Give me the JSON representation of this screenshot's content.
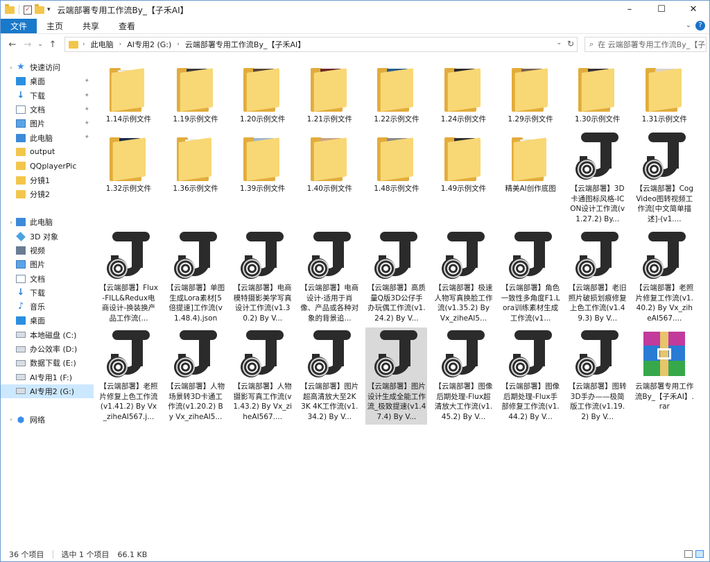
{
  "window": {
    "title": "云端部署专用工作流By_【子禾AI】",
    "controls": {
      "minimize": "–",
      "maximize": "☐",
      "close": "✕"
    }
  },
  "ribbon": {
    "tabs": [
      "文件",
      "主页",
      "共享",
      "查看"
    ],
    "help": "?"
  },
  "address": {
    "crumbs": [
      "此电脑",
      "AI专用2 (G:)",
      "云端部署专用工作流By_【子禾AI】"
    ],
    "search_placeholder": "在 云端部署专用工作流By_【子..."
  },
  "nav": {
    "items": [
      {
        "label": "快速访问",
        "icon": "star-icon",
        "pin": false,
        "sel": false,
        "exp": true
      },
      {
        "label": "桌面",
        "icon": "desktop-icon",
        "pin": true,
        "sel": false,
        "exp": false
      },
      {
        "label": "下载",
        "icon": "download-icon",
        "pin": true,
        "sel": false,
        "exp": false
      },
      {
        "label": "文档",
        "icon": "document-icon",
        "pin": true,
        "sel": false,
        "exp": false
      },
      {
        "label": "图片",
        "icon": "picture-icon",
        "pin": true,
        "sel": false,
        "exp": false
      },
      {
        "label": "此电脑",
        "icon": "computer-icon",
        "pin": true,
        "sel": false,
        "exp": false
      },
      {
        "label": "output",
        "icon": "folder-icon",
        "pin": false,
        "sel": false,
        "exp": false
      },
      {
        "label": "QQplayerPic",
        "icon": "folder-icon",
        "pin": false,
        "sel": false,
        "exp": false
      },
      {
        "label": "分镜1",
        "icon": "folder-icon",
        "pin": false,
        "sel": false,
        "exp": false
      },
      {
        "label": "分镜2",
        "icon": "folder-icon",
        "pin": false,
        "sel": false,
        "exp": false
      },
      {
        "label": "",
        "icon": "",
        "pin": false,
        "sel": false,
        "exp": false
      },
      {
        "label": "此电脑",
        "icon": "computer-icon",
        "pin": false,
        "sel": false,
        "exp": true
      },
      {
        "label": "3D 对象",
        "icon": "3d-objects-icon",
        "pin": false,
        "sel": false,
        "exp": false
      },
      {
        "label": "视频",
        "icon": "video-icon",
        "pin": false,
        "sel": false,
        "exp": false
      },
      {
        "label": "图片",
        "icon": "picture-icon",
        "pin": false,
        "sel": false,
        "exp": false
      },
      {
        "label": "文档",
        "icon": "document-icon",
        "pin": false,
        "sel": false,
        "exp": false
      },
      {
        "label": "下载",
        "icon": "download-icon",
        "pin": false,
        "sel": false,
        "exp": false
      },
      {
        "label": "音乐",
        "icon": "music-icon",
        "pin": false,
        "sel": false,
        "exp": false
      },
      {
        "label": "桌面",
        "icon": "desktop-icon",
        "pin": false,
        "sel": false,
        "exp": false
      },
      {
        "label": "本地磁盘 (C:)",
        "icon": "drive-icon",
        "pin": false,
        "sel": false,
        "exp": false
      },
      {
        "label": "办公效率 (D:)",
        "icon": "drive-icon",
        "pin": false,
        "sel": false,
        "exp": false
      },
      {
        "label": "数据下载 (E:)",
        "icon": "drive-icon",
        "pin": false,
        "sel": false,
        "exp": false
      },
      {
        "label": "AI专用1 (F:)",
        "icon": "drive-icon",
        "pin": false,
        "sel": false,
        "exp": false
      },
      {
        "label": "AI专用2 (G:)",
        "icon": "drive-icon",
        "pin": false,
        "sel": true,
        "exp": false
      },
      {
        "label": "",
        "icon": "",
        "pin": false,
        "sel": false,
        "exp": false
      },
      {
        "label": "网络",
        "icon": "network-icon",
        "pin": false,
        "sel": false,
        "exp": true
      }
    ]
  },
  "files": [
    {
      "label": "1.14示例文件",
      "type": "folder",
      "photo": ""
    },
    {
      "label": "1.19示例文件",
      "type": "folder",
      "photo": "#3a3a3a"
    },
    {
      "label": "1.20示例文件",
      "type": "folder",
      "photo": "#5a4636"
    },
    {
      "label": "1.21示例文件",
      "type": "folder",
      "photo": "#6b2a2a"
    },
    {
      "label": "1.22示例文件",
      "type": "folder",
      "photo": "#2a5e8a"
    },
    {
      "label": "1.24示例文件",
      "type": "folder",
      "photo": "#2b2b2b"
    },
    {
      "label": "1.29示例文件",
      "type": "folder",
      "photo": "#7a6450"
    },
    {
      "label": "1.30示例文件",
      "type": "folder",
      "photo": "#3b3434"
    },
    {
      "label": "1.31示例文件",
      "type": "folder",
      "photo": "#d9d3cc"
    },
    {
      "label": "1.32示例文件",
      "type": "folder",
      "photo": "#1e2a4a"
    },
    {
      "label": "1.36示例文件",
      "type": "folder",
      "photo": ""
    },
    {
      "label": "1.39示例文件",
      "type": "folder",
      "photo": "#9cb6cf"
    },
    {
      "label": "1.40示例文件",
      "type": "folder",
      "photo": "#caa184"
    },
    {
      "label": "1.48示例文件",
      "type": "folder",
      "photo": "#8a8a8a"
    },
    {
      "label": "1.49示例文件",
      "type": "folder",
      "photo": "#2e2e2e"
    },
    {
      "label": "精美AI创作底图",
      "type": "folder",
      "photo": ""
    },
    {
      "label": "【云端部署】3D卡通图标风格-ICON设计工作流(v1.27.2) By...",
      "type": "json"
    },
    {
      "label": "【云端部署】CogVideo图转视频工作流[中文简单描述]-(v1....",
      "type": "json"
    },
    {
      "label": "【云端部署】Flux-FILL&Redux电商设计-换装换产品工作流(...",
      "type": "json"
    },
    {
      "label": "【云端部署】单图生成Lora素材[5倍提速]工作流(v1.48.4).json",
      "type": "json"
    },
    {
      "label": "【云端部署】电商模特摄影美学写真设计工作流(v1.30.2) By V...",
      "type": "json"
    },
    {
      "label": "【云端部署】电商设计-适用于肖像、产品或各种对象的背景追...",
      "type": "json"
    },
    {
      "label": "【云端部署】高质量Q版3D公仔手办玩偶工作流(v1.24.2) By V...",
      "type": "json"
    },
    {
      "label": "【云端部署】极速人物写真换脸工作流(v1.35.2) By Vx_ziheAI5...",
      "type": "json"
    },
    {
      "label": "【云端部署】角色一致性多角度F1.Lora训练素材生成工作流(v1...",
      "type": "json"
    },
    {
      "label": "【云端部署】老旧照片破损划痕修复上色工作流(v1.49.3) By V...",
      "type": "json"
    },
    {
      "label": "【云端部署】老照片修复工作流(v1.40.2) By Vx_ziheAI567....",
      "type": "json"
    },
    {
      "label": "【云端部署】老照片修复上色工作流(v1.41.2) By Vx_ziheAI567.j...",
      "type": "json"
    },
    {
      "label": "【云端部署】人物场景转3D卡通工作流(v1.20.2) By Vx_ziheAI5...",
      "type": "json"
    },
    {
      "label": "【云端部署】人物摄影写真工作流(v1.43.2) By Vx_ziheAI567....",
      "type": "json"
    },
    {
      "label": "【云端部署】图片超高清放大至2K 3K 4K工作流(v1.34.2) By V...",
      "type": "json"
    },
    {
      "label": "【云端部署】图片设计生成全能工作流_极致提速(v1.47.4) By V...",
      "type": "json",
      "sel": true
    },
    {
      "label": "【云端部署】图像后期处理-Flux超清放大工作流(v1.45.2) By V...",
      "type": "json"
    },
    {
      "label": "【云端部署】图像后期处理-Flux手部修复工作流(v1.44.2) By V...",
      "type": "json"
    },
    {
      "label": "【云端部署】图转3D手办——极简版工作流(v1.19.2) By V...",
      "type": "json"
    },
    {
      "label": "云端部署专用工作流By_【子禾AI】.rar",
      "type": "rar"
    }
  ],
  "status": {
    "count": "36 个项目",
    "selected": "选中 1 个项目",
    "size": "66.1 KB"
  }
}
